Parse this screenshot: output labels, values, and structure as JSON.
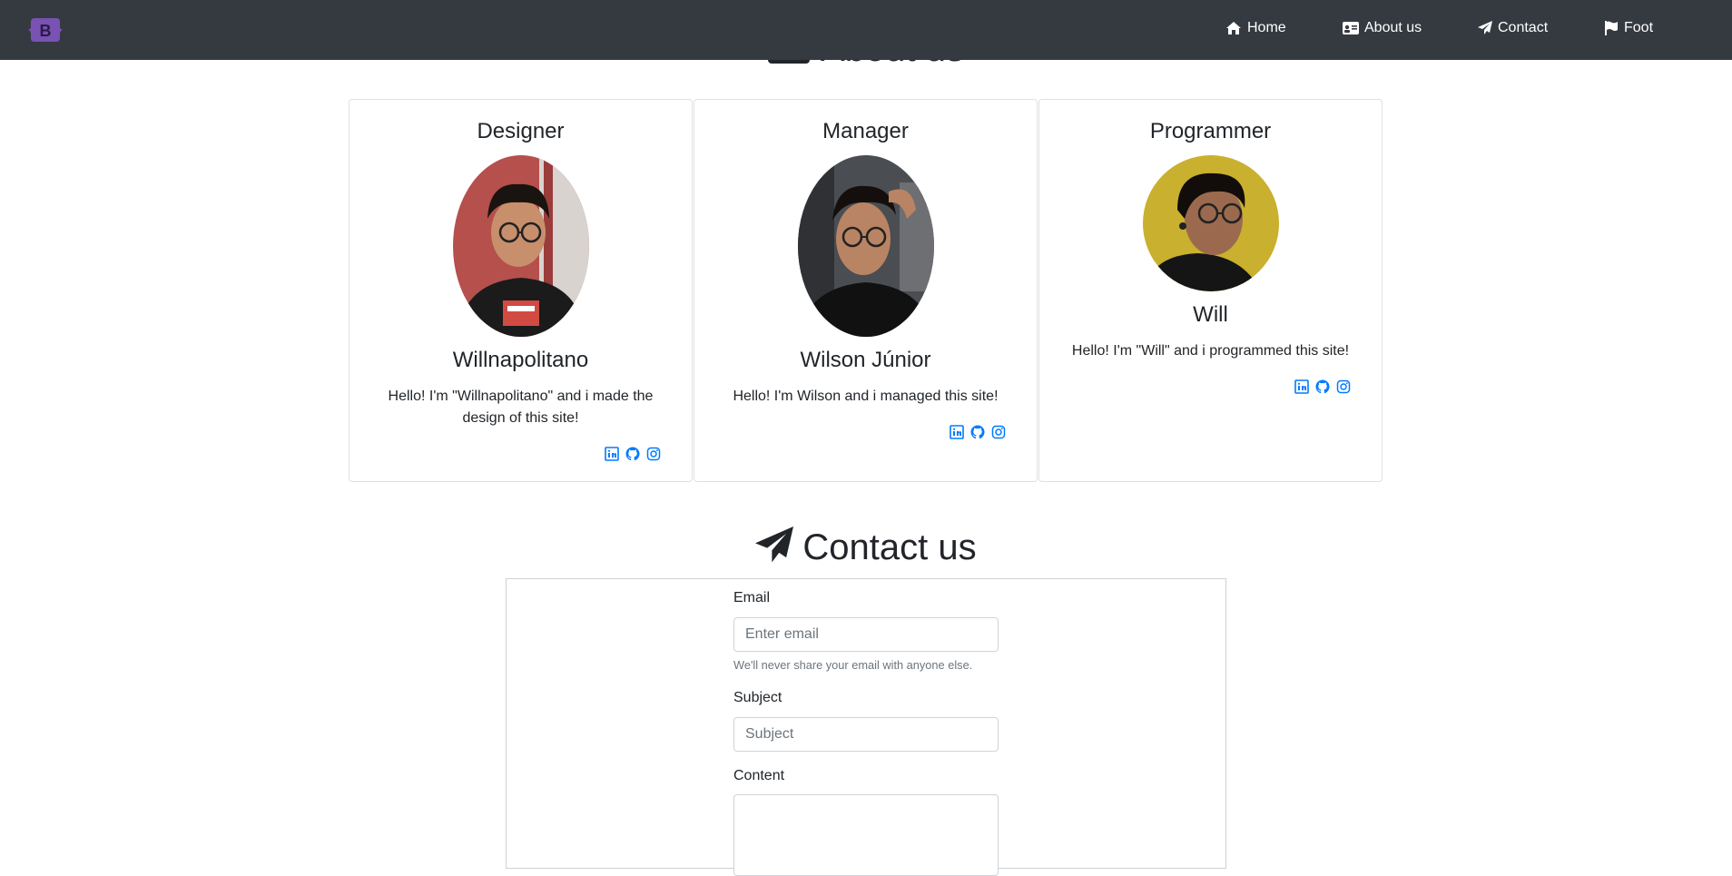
{
  "nav": {
    "brand_letter": "B",
    "links": [
      {
        "label": "Home",
        "icon": "home-icon"
      },
      {
        "label": "About us",
        "icon": "id-card-icon"
      },
      {
        "label": "Contact",
        "icon": "paper-plane-icon"
      },
      {
        "label": "Foot",
        "icon": "flag-icon"
      }
    ]
  },
  "about": {
    "heading": "About us",
    "cards": [
      {
        "role": "Designer",
        "name": "Willnapolitano",
        "description": "Hello! I'm \"Willnapolitano\" and i made the design of this site!"
      },
      {
        "role": "Manager",
        "name": "Wilson Júnior",
        "description": "Hello! I'm Wilson and i managed this site!"
      },
      {
        "role": "Programmer",
        "name": "Will",
        "description": "Hello! I'm \"Will\" and i programmed this site!"
      }
    ],
    "social_icons": [
      "linkedin-icon",
      "github-icon",
      "instagram-icon"
    ]
  },
  "contact": {
    "heading": "Contact us",
    "email_label": "Email",
    "email_placeholder": "Enter email",
    "email_help": "We'll never share your email with anyone else.",
    "subject_label": "Subject",
    "subject_placeholder": "Subject",
    "content_label": "Content"
  },
  "colors": {
    "navbar": "#343a40",
    "brand": "#7952b3",
    "link_accent": "#007bff"
  }
}
